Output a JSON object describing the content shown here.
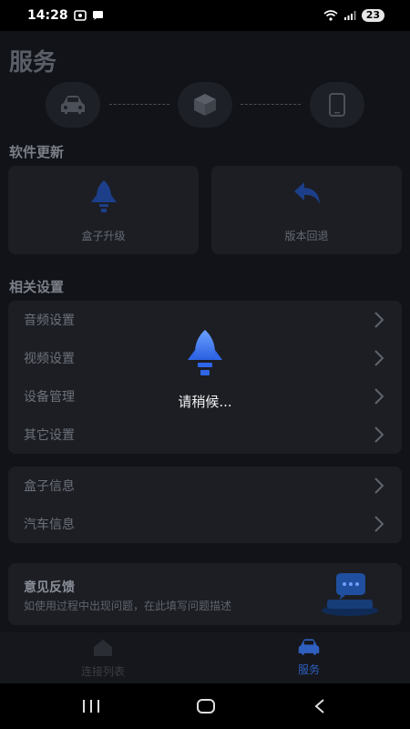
{
  "status": {
    "time": "14:28",
    "battery": "23"
  },
  "page": {
    "title": "服务"
  },
  "software_update": {
    "title": "软件更新",
    "cards": [
      {
        "label": "盒子升级"
      },
      {
        "label": "版本回退"
      }
    ]
  },
  "settings": {
    "title": "相关设置",
    "items": [
      {
        "label": "音频设置"
      },
      {
        "label": "视频设置"
      },
      {
        "label": "设备管理"
      },
      {
        "label": "其它设置"
      }
    ]
  },
  "info": {
    "items": [
      {
        "label": "盒子信息"
      },
      {
        "label": "汽车信息"
      }
    ]
  },
  "feedback": {
    "title": "意见反馈",
    "description": "如使用过程中出现问题，在此填写问题描述"
  },
  "bottom_nav": {
    "items": [
      {
        "label": "连接列表"
      },
      {
        "label": "服务"
      }
    ]
  },
  "loading": {
    "text": "请稍候..."
  },
  "colors": {
    "accent": "#3d7bff",
    "active_nav": "#2f5fbf",
    "background": "#111318",
    "card": "#1c1e24"
  },
  "icons": [
    "car-icon",
    "box-icon",
    "phone-icon",
    "rocket-icon",
    "undo-icon",
    "chevron-right-icon",
    "chat-bubble-icon",
    "home-icon",
    "recent-apps-icon",
    "home-button-icon",
    "back-icon"
  ]
}
